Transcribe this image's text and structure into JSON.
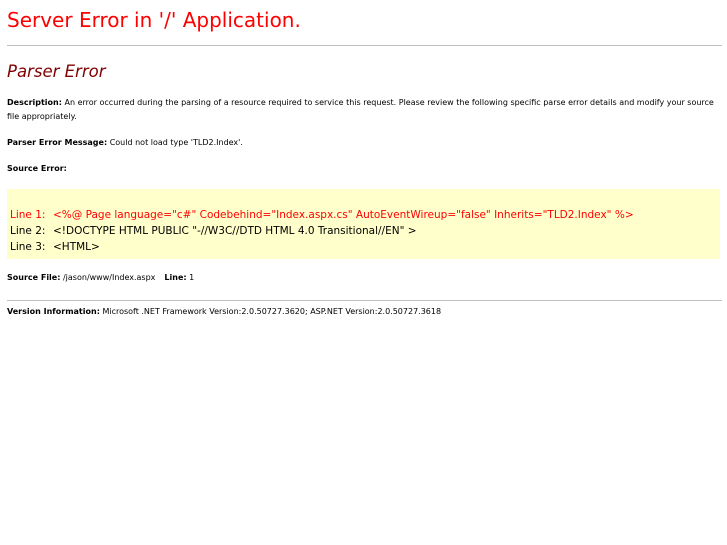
{
  "page": {
    "app_title": "Server Error in '/' Application.",
    "error_heading": "Parser Error",
    "description": {
      "label": "Description:",
      "text": "An error occurred during the parsing of a resource required to service this request. Please review the following specific parse error details and modify your source file appropriately."
    },
    "parser_message": {
      "label": "Parser Error Message:",
      "text": "Could not load type 'TLD2.Index'."
    },
    "source_error": {
      "label": "Source Error:"
    },
    "code_lines": [
      {
        "number": "Line 1:",
        "text": "<%@ Page language=\"c#\" Codebehind=\"Index.aspx.cs\" AutoEventWireup=\"false\" Inherits=\"TLD2.Index\" %>"
      },
      {
        "number": "Line 2:",
        "text": "<!DOCTYPE HTML PUBLIC \"-//W3C//DTD HTML 4.0 Transitional//EN\" >"
      },
      {
        "number": "Line 3:",
        "text": "<HTML>"
      }
    ],
    "source_file": {
      "label": "Source File:",
      "path": "/jason/www/Index.aspx",
      "line_label": "Line:",
      "line_value": "1"
    },
    "version_info": {
      "label": "Version Information:",
      "text": "Microsoft .NET Framework Version:2.0.50727.3620; ASP.NET Version:2.0.50727.3618"
    }
  },
  "colors": {
    "title": "#ff0000",
    "heading": "#800000",
    "code_background": "#ffffcc",
    "error_line": "#ff0000",
    "rule": "#c0c0c0"
  }
}
